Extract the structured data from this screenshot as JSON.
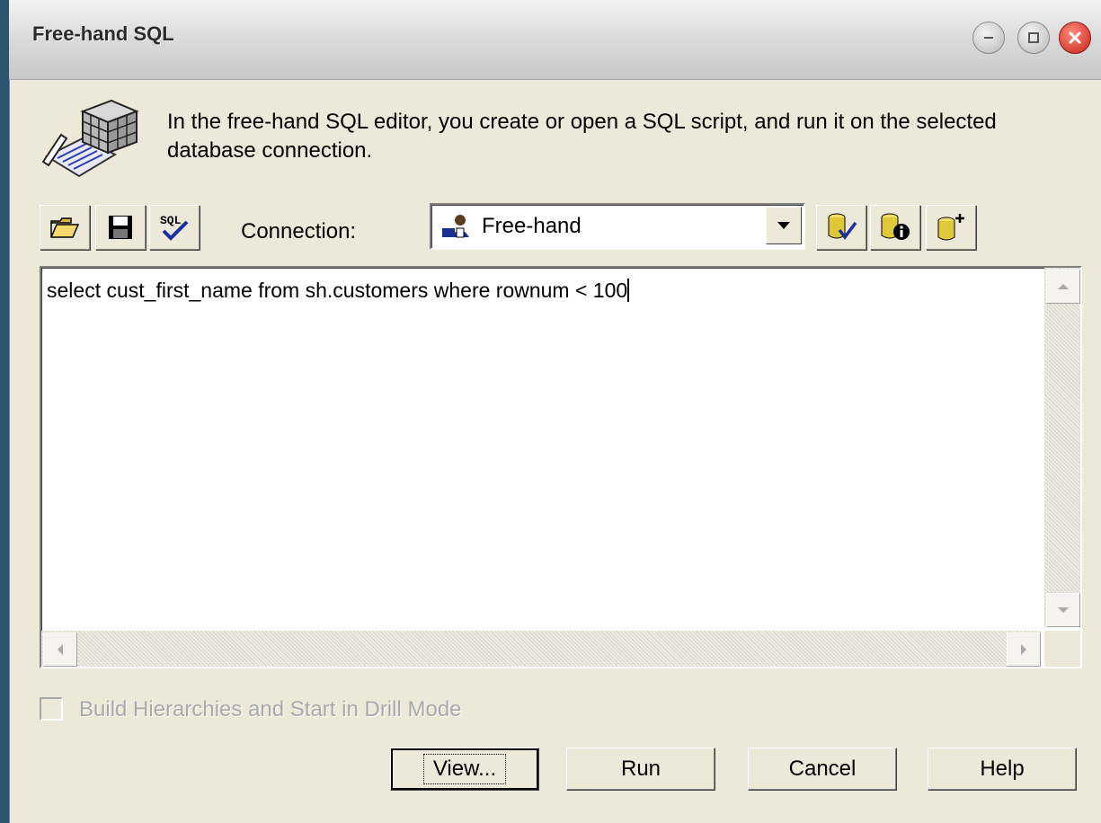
{
  "window": {
    "title": "Free-hand SQL",
    "controls": [
      "minimize-icon",
      "maximize-icon",
      "close-icon"
    ]
  },
  "header": {
    "icon": "sql-editor-cube-icon",
    "description": "In the free-hand SQL editor, you create or open a SQL script, and run it on the selected database connection."
  },
  "toolbar": {
    "left_tools": [
      {
        "name": "open-button",
        "icon": "folder-open-icon"
      },
      {
        "name": "save-button",
        "icon": "floppy-disk-icon"
      },
      {
        "name": "validate-sql-button",
        "icon": "sql-check-icon"
      }
    ],
    "connection_label": "Connection:",
    "connection_value": "Free-hand",
    "right_tools": [
      {
        "name": "test-connection-button",
        "icon": "database-check-icon"
      },
      {
        "name": "connection-info-button",
        "icon": "database-info-icon"
      },
      {
        "name": "new-connection-button",
        "icon": "database-add-icon"
      }
    ]
  },
  "editor": {
    "sql": "select cust_first_name from sh.customers where rownum < 100"
  },
  "options": {
    "build_hierarchies_label": "Build Hierarchies and Start in Drill Mode",
    "build_hierarchies_checked": false,
    "build_hierarchies_enabled": false
  },
  "buttons": {
    "view": "View...",
    "run": "Run",
    "cancel": "Cancel",
    "help": "Help"
  },
  "colors": {
    "dialog_bg": "#ece9d8",
    "desktop_bg": "#2a5470",
    "close_button": "#c8241a"
  }
}
